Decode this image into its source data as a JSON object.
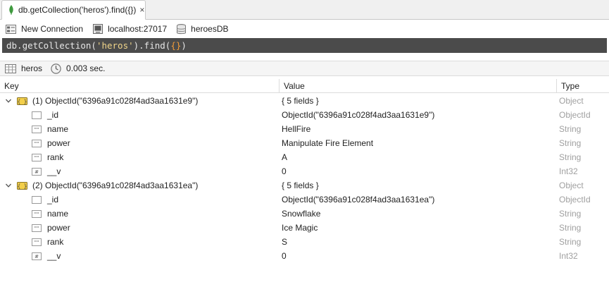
{
  "tab": {
    "title": "db.getCollection('heros').find({})",
    "close": "×"
  },
  "connection": {
    "new_connection": "New Connection",
    "host": "localhost:27017",
    "database": "heroesDB"
  },
  "query": {
    "prefix": "db.getCollection(",
    "arg": "'heros'",
    "middle": ").find(",
    "body": "{}",
    "suffix": ")"
  },
  "result_info": {
    "collection": "heros",
    "time": "0.003 sec."
  },
  "columns": {
    "key": "Key",
    "value": "Value",
    "type": "Type"
  },
  "rows": [
    {
      "key": "(1) ObjectId(\"6396a91c028f4ad3aa1631e9\")",
      "value": "{ 5 fields }",
      "type": "Object"
    },
    {
      "key": "_id",
      "value": "ObjectId(\"6396a91c028f4ad3aa1631e9\")",
      "type": "ObjectId"
    },
    {
      "key": "name",
      "value": "HellFire",
      "type": "String"
    },
    {
      "key": "power",
      "value": "Manipulate Fire Element",
      "type": "String"
    },
    {
      "key": "rank",
      "value": "A",
      "type": "String"
    },
    {
      "key": "__v",
      "value": "0",
      "type": "Int32"
    },
    {
      "key": "(2) ObjectId(\"6396a91c028f4ad3aa1631ea\")",
      "value": "{ 5 fields }",
      "type": "Object"
    },
    {
      "key": "_id",
      "value": "ObjectId(\"6396a91c028f4ad3aa1631ea\")",
      "type": "ObjectId"
    },
    {
      "key": "name",
      "value": "Snowflake",
      "type": "String"
    },
    {
      "key": "power",
      "value": "Ice Magic",
      "type": "String"
    },
    {
      "key": "rank",
      "value": "S",
      "type": "String"
    },
    {
      "key": "__v",
      "value": "0",
      "type": "Int32"
    }
  ],
  "colors": {
    "query_bg": "#4b4b4b",
    "string_literal": "#f0d58a",
    "brace": "#f29c39",
    "leaf_green": "#3f9a3f"
  }
}
